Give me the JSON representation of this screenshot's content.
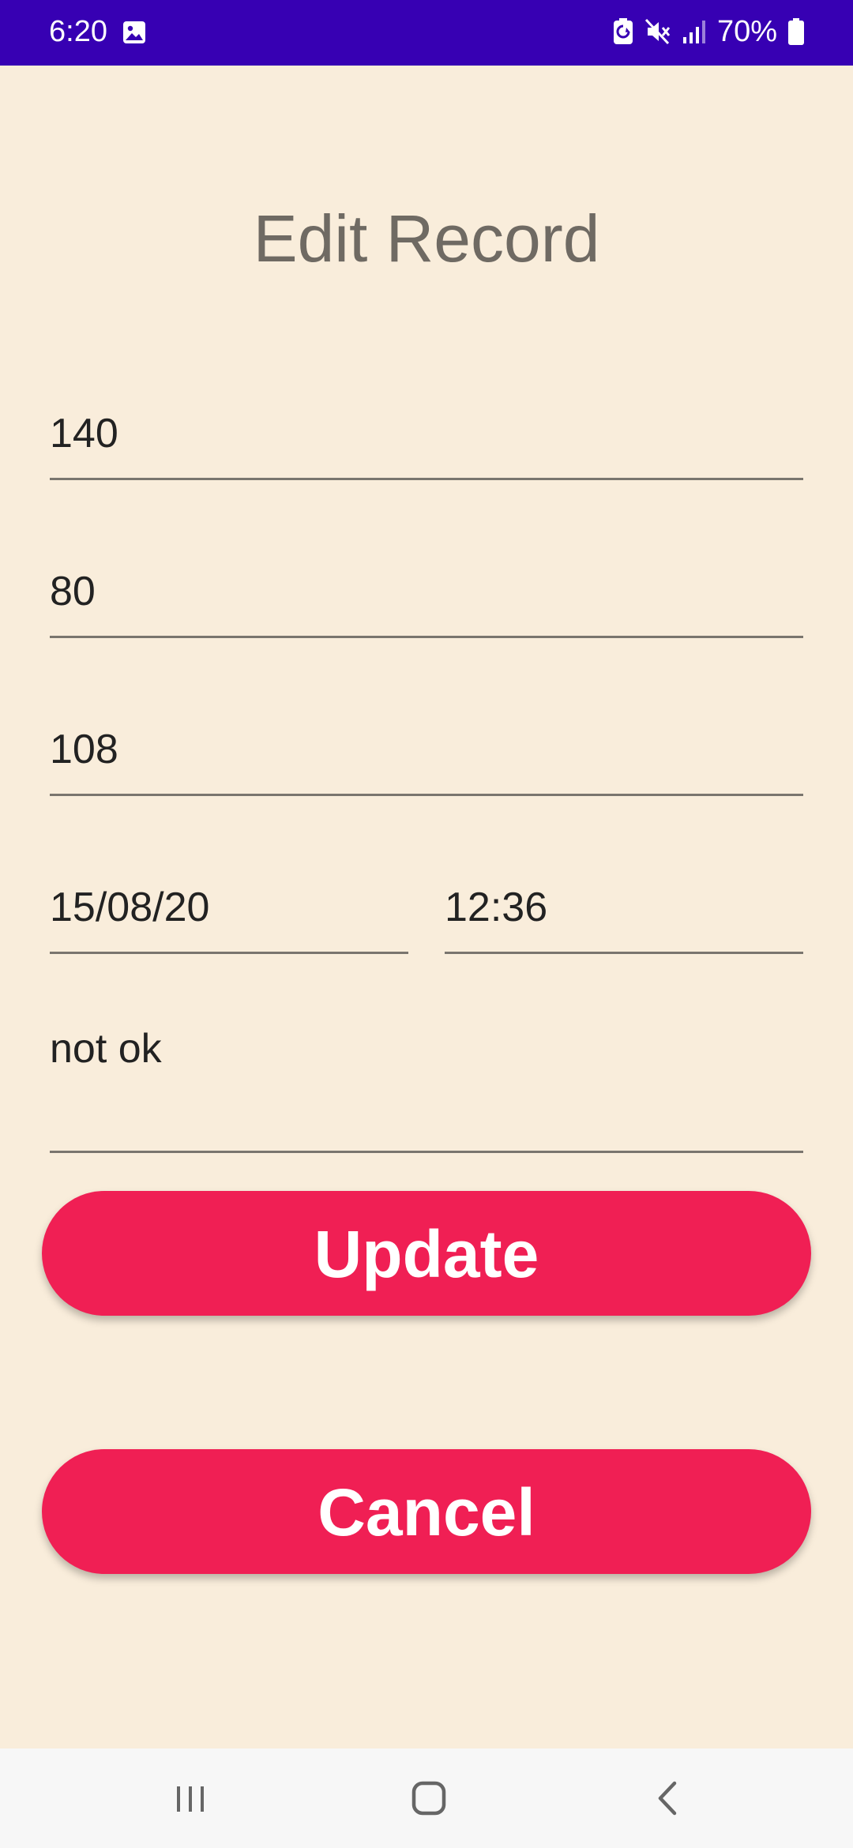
{
  "status_bar": {
    "time": "6:20",
    "battery": "70%",
    "icons": [
      "gallery-icon",
      "battery-saver-icon",
      "mute-icon",
      "signal-icon",
      "battery-icon"
    ],
    "background": "#3700b3"
  },
  "page": {
    "title": "Edit Record"
  },
  "form": {
    "systolic": {
      "value": "140"
    },
    "diastolic": {
      "value": "80"
    },
    "pulse": {
      "value": "108"
    },
    "date": {
      "value": "15/08/20"
    },
    "time": {
      "value": "12:36"
    },
    "note": {
      "value": "not ok"
    }
  },
  "buttons": {
    "update": "Update",
    "cancel": "Cancel",
    "color": "#f01f54"
  },
  "nav_bar": {
    "icons": [
      "recent-apps-icon",
      "home-icon",
      "back-icon"
    ]
  },
  "colors": {
    "background": "#f9eddb",
    "title": "#6f6a63"
  }
}
